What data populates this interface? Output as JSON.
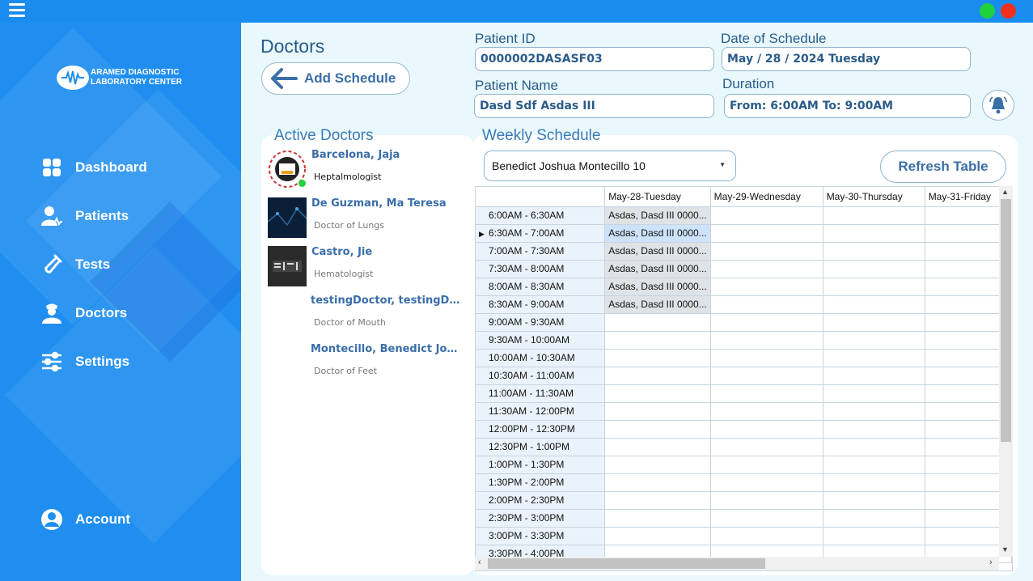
{
  "sidebar": {
    "logo_line1": "ARAMED DIAGNOSTIC",
    "logo_line2": "LABORATORY CENTER",
    "items": [
      {
        "label": "Dashboard",
        "icon": "dashboard-icon"
      },
      {
        "label": "Patients",
        "icon": "patients-icon"
      },
      {
        "label": "Tests",
        "icon": "test-tube-icon"
      },
      {
        "label": "Doctors",
        "icon": "doctor-icon"
      },
      {
        "label": "Settings",
        "icon": "sliders-icon"
      }
    ],
    "account_label": "Account"
  },
  "header": {
    "title": "Doctors",
    "add_schedule_label": "Add Schedule"
  },
  "form": {
    "patient_id_label": "Patient ID",
    "patient_id_value": "0000002DASASF03",
    "date_label": "Date of Schedule",
    "date_value": "May / 28 / 2024 Tuesday",
    "patient_name_label": "Patient Name",
    "patient_name_value": "Dasd Sdf Asdas III",
    "duration_label": "Duration",
    "duration_value": "From: 6:00AM To: 9:00AM"
  },
  "active_doctors": {
    "title": "Active Doctors",
    "doctors": [
      {
        "name": "Barcelona, Jaja",
        "specialty": "Heptalmologist",
        "online": true
      },
      {
        "name": "De Guzman, Ma Teresa",
        "specialty": "Doctor of Lungs"
      },
      {
        "name": "Castro, Jie",
        "specialty": "Hematologist"
      },
      {
        "name": "testingDoctor, testingDoc...",
        "specialty": "Doctor of Mouth"
      },
      {
        "name": "Montecillo, Benedict Josh...",
        "specialty": "Doctor of Feet"
      }
    ]
  },
  "schedule": {
    "title": "Weekly Schedule",
    "selected_doctor": "Benedict Joshua Montecillo 10",
    "refresh_label": "Refresh Table",
    "columns": [
      "",
      "May-28-Tuesday",
      "May-29-Wednesday",
      "May-30-Thursday",
      "May-31-Friday"
    ],
    "rows": [
      {
        "time": "6:00AM - 6:30AM",
        "cells": [
          "Asdas, Dasd III 0000...",
          "",
          "",
          ""
        ]
      },
      {
        "time": "6:30AM - 7:00AM",
        "cells": [
          "Asdas, Dasd III 0000...",
          "",
          "",
          ""
        ],
        "current": true
      },
      {
        "time": "7:00AM - 7:30AM",
        "cells": [
          "Asdas, Dasd III 0000...",
          "",
          "",
          ""
        ]
      },
      {
        "time": "7:30AM - 8:00AM",
        "cells": [
          "Asdas, Dasd III 0000...",
          "",
          "",
          ""
        ]
      },
      {
        "time": "8:00AM - 8:30AM",
        "cells": [
          "Asdas, Dasd III 0000...",
          "",
          "",
          ""
        ]
      },
      {
        "time": "8:30AM - 9:00AM",
        "cells": [
          "Asdas, Dasd III 0000...",
          "",
          "",
          ""
        ]
      },
      {
        "time": "9:00AM - 9:30AM",
        "cells": [
          "",
          "",
          "",
          ""
        ]
      },
      {
        "time": "9:30AM - 10:00AM",
        "cells": [
          "",
          "",
          "",
          ""
        ]
      },
      {
        "time": "10:00AM - 10:30AM",
        "cells": [
          "",
          "",
          "",
          ""
        ]
      },
      {
        "time": "10:30AM - 11:00AM",
        "cells": [
          "",
          "",
          "",
          ""
        ]
      },
      {
        "time": "11:00AM - 11:30AM",
        "cells": [
          "",
          "",
          "",
          ""
        ]
      },
      {
        "time": "11:30AM - 12:00PM",
        "cells": [
          "",
          "",
          "",
          ""
        ]
      },
      {
        "time": "12:00PM - 12:30PM",
        "cells": [
          "",
          "",
          "",
          ""
        ]
      },
      {
        "time": "12:30PM - 1:00PM",
        "cells": [
          "",
          "",
          "",
          ""
        ]
      },
      {
        "time": "1:00PM - 1:30PM",
        "cells": [
          "",
          "",
          "",
          ""
        ]
      },
      {
        "time": "1:30PM - 2:00PM",
        "cells": [
          "",
          "",
          "",
          ""
        ]
      },
      {
        "time": "2:00PM - 2:30PM",
        "cells": [
          "",
          "",
          "",
          ""
        ]
      },
      {
        "time": "2:30PM - 3:00PM",
        "cells": [
          "",
          "",
          "",
          ""
        ]
      },
      {
        "time": "3:00PM - 3:30PM",
        "cells": [
          "",
          "",
          "",
          ""
        ]
      },
      {
        "time": "3:30PM - 4:00PM",
        "cells": [
          "",
          "",
          "",
          ""
        ]
      }
    ]
  },
  "colors": {
    "sidebar": "#1f8ef0",
    "titlebar": "#1a8cf0",
    "accent_text": "#3b6fa8",
    "background": "#e8f8fc"
  }
}
